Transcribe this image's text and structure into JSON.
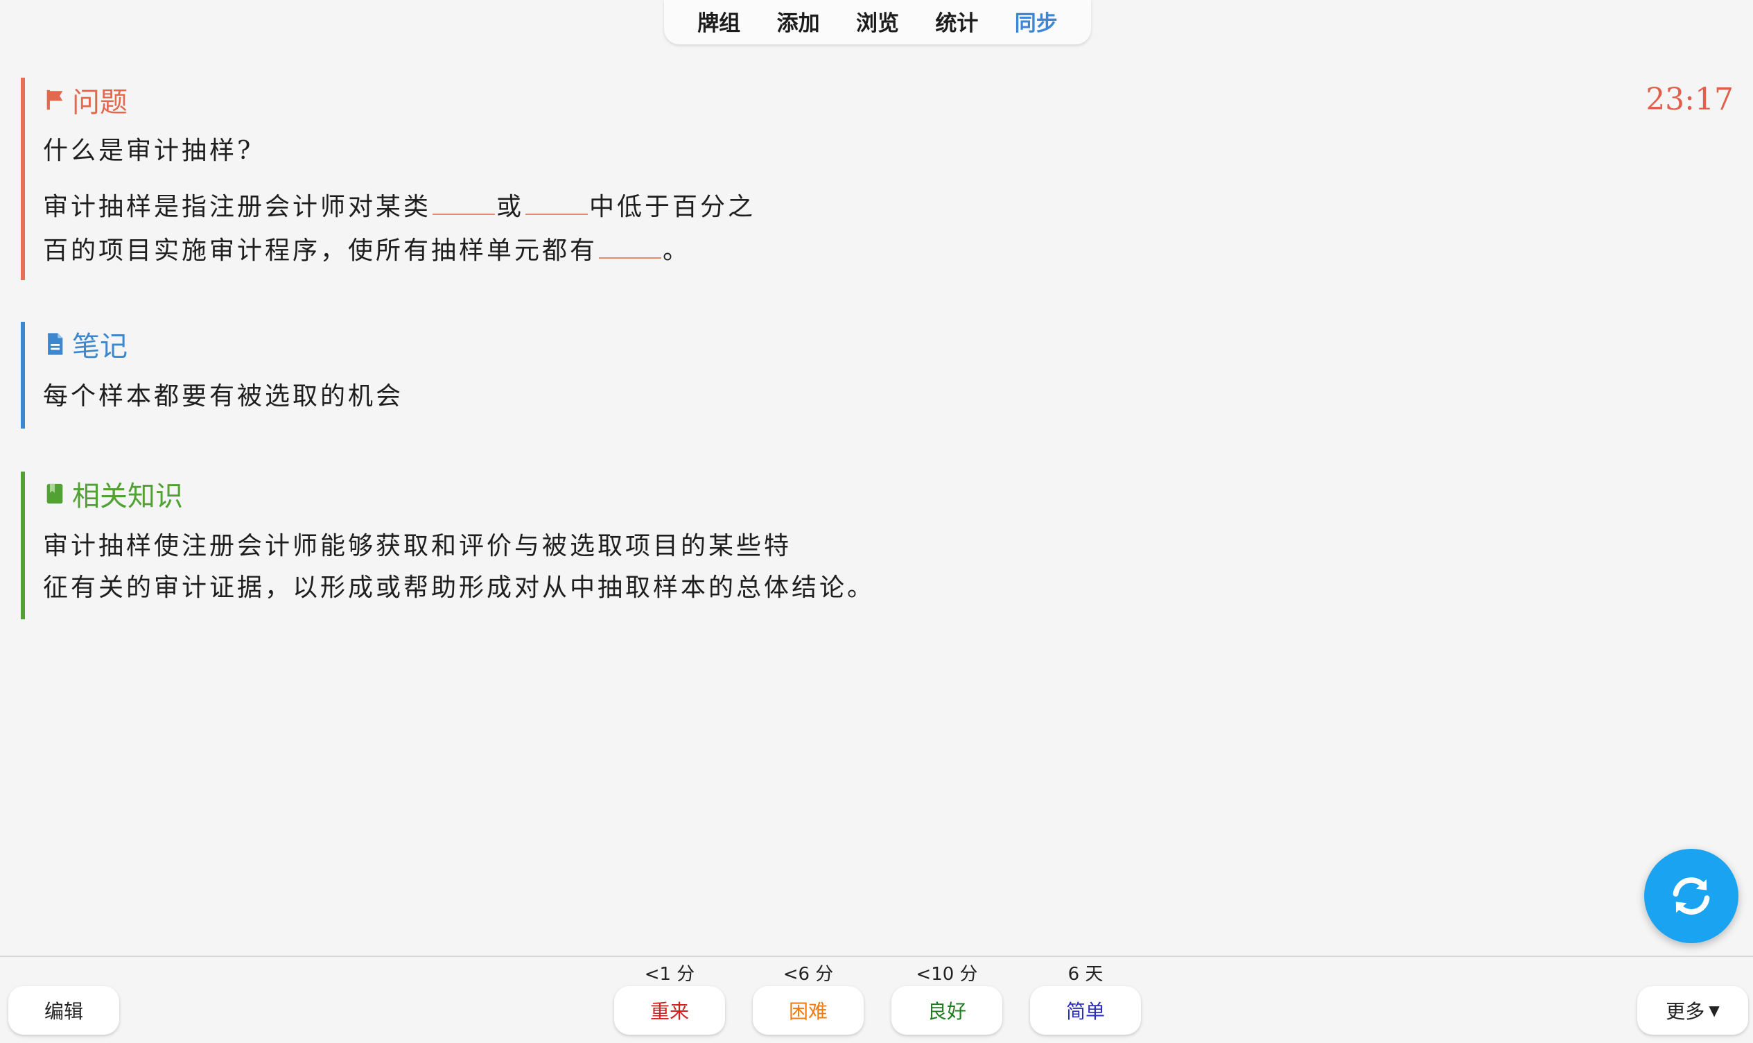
{
  "topnav": {
    "tabs": [
      {
        "label": "牌组"
      },
      {
        "label": "添加"
      },
      {
        "label": "浏览"
      },
      {
        "label": "统计"
      },
      {
        "label": "同步"
      }
    ],
    "active_tab": "同步"
  },
  "timer": "23:17",
  "question": {
    "title": "问题",
    "prompt": "什么是审计抽样?",
    "cloze_line1_a": "审计抽样是指注册会计师对某类",
    "cloze_line1_b": "或",
    "cloze_line1_c": "中低于百分之",
    "cloze_line2_a": "百的项目实施审计程序，使所有抽样单元都有",
    "cloze_line2_b": "。"
  },
  "notes": {
    "title": "笔记",
    "text": "每个样本都要有被选取的机会"
  },
  "related": {
    "title": "相关知识",
    "line1": "审计抽样使注册会计师能够获取和评价与被选取项目的某些特",
    "line2": "征有关的审计证据，以形成或帮助形成对从中抽取样本的总体结论。"
  },
  "bottombar": {
    "edit_label": "编辑",
    "more_label": "更多",
    "answers": [
      {
        "interval": "<1 分",
        "label": "重来"
      },
      {
        "interval": "<6 分",
        "label": "困难"
      },
      {
        "interval": "<10 分",
        "label": "良好"
      },
      {
        "interval": "6 天",
        "label": "简单"
      }
    ]
  },
  "colors": {
    "question_accent": "#e66f55",
    "notes_accent": "#3d87cf",
    "related_accent": "#52a135",
    "sync_fab": "#1aa3f0",
    "active_tab": "#3c86d8"
  },
  "icons": {
    "question": "flag-icon",
    "notes": "document-icon",
    "related": "bookmark-icon",
    "fab": "sync-icon",
    "more": "caret-down-icon"
  }
}
